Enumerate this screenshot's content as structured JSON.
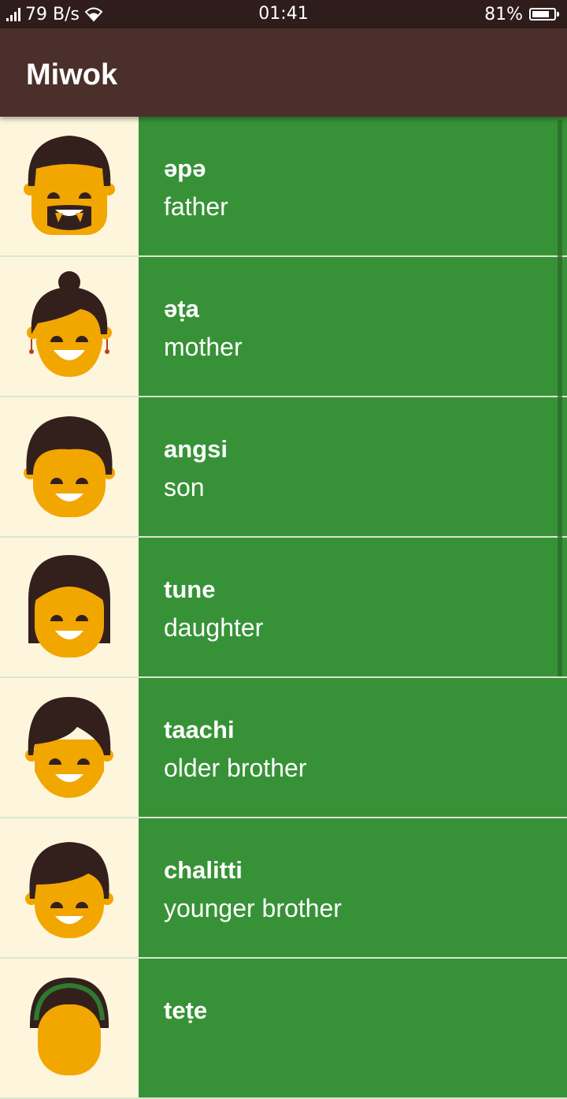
{
  "status_bar": {
    "net_speed": "79 B/s",
    "time": "01:41",
    "battery": "81%",
    "battery_level": 0.81
  },
  "app_bar": {
    "title": "Miwok"
  },
  "colors": {
    "text_background": "#379237",
    "image_background": "#fef6dc",
    "app_bar": "#4b2f2b",
    "status_bar": "#2e1d1b"
  },
  "list": {
    "items": [
      {
        "miwok": "əpə",
        "english": "father",
        "icon": "family-father-icon"
      },
      {
        "miwok": "əṭa",
        "english": "mother",
        "icon": "family-mother-icon"
      },
      {
        "miwok": "angsi",
        "english": "son",
        "icon": "family-son-icon"
      },
      {
        "miwok": "tune",
        "english": "daughter",
        "icon": "family-daughter-icon"
      },
      {
        "miwok": "taachi",
        "english": "older brother",
        "icon": "family-older-brother-icon"
      },
      {
        "miwok": "chalitti",
        "english": "younger brother",
        "icon": "family-younger-brother-icon"
      },
      {
        "miwok": "teṭe",
        "english": "",
        "icon": "family-older-sister-icon"
      }
    ]
  }
}
